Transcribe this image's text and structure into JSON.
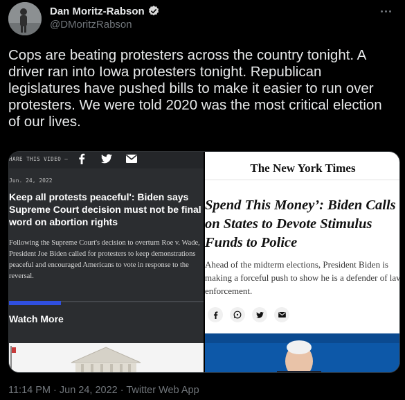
{
  "author": {
    "display_name": "Dan Moritz-Rabson",
    "handle": "@DMoritzRabson"
  },
  "tweet": {
    "text": "Cops are beating protesters across the country tonight. A driver ran into Iowa protesters tonight. Republican legislatures have pushed bills to make it easier to run over protesters. We were told 2020 was the most critical election of our lives."
  },
  "media": {
    "left": {
      "share_label": "HARE THIS VIDEO —",
      "share_icons": [
        "f",
        "twitter-bird-icon",
        "mail-icon"
      ],
      "date": "Jun. 24, 2022",
      "headline": "Keep all protests peaceful': Biden says Supreme Court decision must not be final word on abortion rights",
      "body": "Following the Supreme Court's decision to overturn Roe v. Wade, President Joe Biden called for protesters to keep demonstrations peaceful and encouraged Americans to vote in response to the reversal.",
      "watch_more": "Watch More"
    },
    "right": {
      "masthead": "The New York Times",
      "headline": "Spend This Money’: Biden Calls on States to Devote Stimulus Funds to Police",
      "body": "Ahead of the midterm elections, President Biden is making a forceful push to show he is a defender of law enforcement.",
      "share_icons": [
        "facebook-icon",
        "whatsapp-icon",
        "twitter-icon",
        "email-icon"
      ]
    }
  },
  "meta": {
    "timestamp": "11:14 PM · Jun 24, 2022 · Twitter Web App"
  },
  "colors": {
    "background": "#000000",
    "primary_text": "#e7e9ea",
    "secondary_text": "#71767b",
    "verified": "#d9d9d9",
    "accent_bar": "#2f4fe0"
  }
}
